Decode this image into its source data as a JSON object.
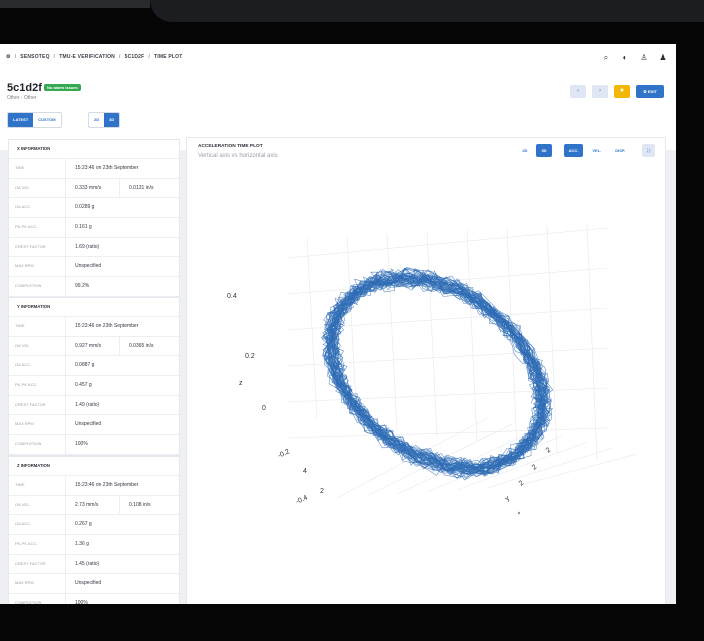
{
  "breadcrumb": [
    "SENSOTEQ",
    "TMU-E VERIFICATION",
    "5C1D2F",
    "TIME PLOT"
  ],
  "asset": {
    "name": "5c1d2f",
    "subtitle": "Other - Other",
    "badge": "No alarm issues"
  },
  "header_buttons": {
    "edit": "EDIT"
  },
  "range_tabs": [
    {
      "label": "LATEST",
      "active": true
    },
    {
      "label": "CUSTOM",
      "active": false
    }
  ],
  "dim_tabs": [
    {
      "label": "2D",
      "active": false
    },
    {
      "label": "3D",
      "active": true
    }
  ],
  "panels": [
    {
      "title": "X INFORMATION",
      "rows": [
        {
          "k": "TIME",
          "v": "15:23:46 on 23th September"
        },
        {
          "k": "OA VEL.",
          "v": "0.333 mm/s",
          "v2": "0.0131 in/s"
        },
        {
          "k": "OA ACC.",
          "v": "0.0289 g"
        },
        {
          "k": "PK-PK ACC.",
          "v": "0.161 g"
        },
        {
          "k": "CREST FACTOR",
          "v": "1.69 (ratio)"
        },
        {
          "k": "MAX RPM",
          "v": "Unspecified"
        },
        {
          "k": "COMPLETION",
          "v": "99.2%"
        }
      ]
    },
    {
      "title": "Y INFORMATION",
      "rows": [
        {
          "k": "TIME",
          "v": "15:23:46 on 23th September"
        },
        {
          "k": "OA VEL.",
          "v": "0.927 mm/s",
          "v2": "0.0365 in/s"
        },
        {
          "k": "OA ACC.",
          "v": "0.0887 g"
        },
        {
          "k": "PK-PK ACC.",
          "v": "0.457 g"
        },
        {
          "k": "CREST FACTOR",
          "v": "1.49 (ratio)"
        },
        {
          "k": "MAX RPM",
          "v": "Unspecified"
        },
        {
          "k": "COMPLETION",
          "v": "100%"
        }
      ]
    },
    {
      "title": "Z INFORMATION",
      "rows": [
        {
          "k": "TIME",
          "v": "15:23:46 on 23th September"
        },
        {
          "k": "OA VEL.",
          "v": "2.73 mm/s",
          "v2": "0.108 in/s"
        },
        {
          "k": "OA ACC.",
          "v": "0.267 g"
        },
        {
          "k": "PK-PK ACC.",
          "v": "1.36 g"
        },
        {
          "k": "CREST FACTOR",
          "v": "1.45 (ratio)"
        },
        {
          "k": "MAX RPM",
          "v": "Unspecified"
        },
        {
          "k": "COMPLETION",
          "v": "100%"
        }
      ]
    }
  ],
  "plot": {
    "title": "ACCELERATION TIME PLOT",
    "subtitle": "Vertical axis vs horizontal axis",
    "view_buttons": [
      {
        "label": "2D",
        "active": false
      },
      {
        "label": "3D",
        "active": true
      }
    ],
    "mode_buttons": [
      {
        "label": "ACC.",
        "active": true
      },
      {
        "label": "VEL.",
        "active": false
      },
      {
        "label": "DISP.",
        "active": false
      }
    ],
    "z_axis_label": "z",
    "z_ticks": [
      "0.4",
      "0.2",
      "0",
      "-0.2",
      "-0.4"
    ],
    "y_axis_label": "y",
    "trace_color": "#2f6db5"
  },
  "colors": {
    "accent": "#2f74c9",
    "success": "#35a852",
    "star": "#f2b705"
  }
}
